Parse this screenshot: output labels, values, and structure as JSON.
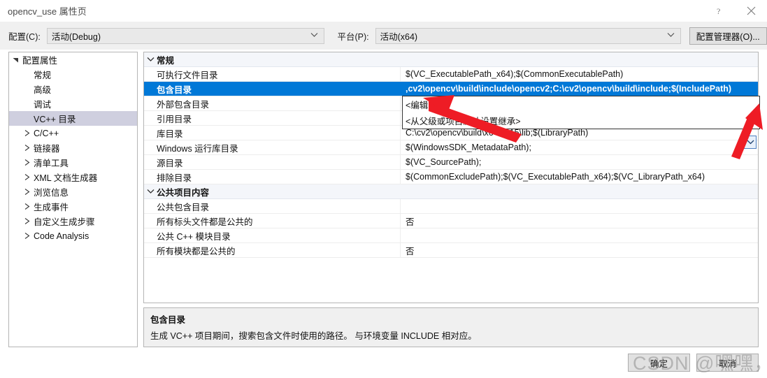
{
  "window": {
    "title": "opencv_use 属性页",
    "help_icon": "help-icon",
    "close_icon": "close-icon"
  },
  "toolbar": {
    "configuration_label": "配置(C):",
    "configuration_value": "活动(Debug)",
    "platform_label": "平台(P):",
    "platform_value": "活动(x64)",
    "config_manager_label": "配置管理器(O)..."
  },
  "tree": {
    "items": [
      {
        "label": "配置属性",
        "indent": 0,
        "twisty": "expanded",
        "selected": false
      },
      {
        "label": "常规",
        "indent": 1,
        "twisty": "none",
        "selected": false
      },
      {
        "label": "高级",
        "indent": 1,
        "twisty": "none",
        "selected": false
      },
      {
        "label": "调试",
        "indent": 1,
        "twisty": "none",
        "selected": false
      },
      {
        "label": "VC++ 目录",
        "indent": 1,
        "twisty": "none",
        "selected": true
      },
      {
        "label": "C/C++",
        "indent": 1,
        "twisty": "collapsed",
        "selected": false
      },
      {
        "label": "链接器",
        "indent": 1,
        "twisty": "collapsed",
        "selected": false
      },
      {
        "label": "清单工具",
        "indent": 1,
        "twisty": "collapsed",
        "selected": false
      },
      {
        "label": "XML 文档生成器",
        "indent": 1,
        "twisty": "collapsed",
        "selected": false
      },
      {
        "label": "浏览信息",
        "indent": 1,
        "twisty": "collapsed",
        "selected": false
      },
      {
        "label": "生成事件",
        "indent": 1,
        "twisty": "collapsed",
        "selected": false
      },
      {
        "label": "自定义生成步骤",
        "indent": 1,
        "twisty": "collapsed",
        "selected": false
      },
      {
        "label": "Code Analysis",
        "indent": 1,
        "twisty": "collapsed",
        "selected": false
      }
    ]
  },
  "grid": {
    "sections": [
      {
        "title": "常规",
        "rows": [
          {
            "name": "可执行文件目录",
            "value": "$(VC_ExecutablePath_x64);$(CommonExecutablePath)",
            "selected": false
          },
          {
            "name": "包含目录",
            "value": ",cv2\\opencv\\build\\include\\opencv2;C:\\cv2\\opencv\\build\\include;$(IncludePath)",
            "selected": true
          },
          {
            "name": "外部包含目录",
            "value": "",
            "selected": false
          },
          {
            "name": "引用目录",
            "value": "",
            "selected": false
          },
          {
            "name": "库目录",
            "value": "C:\\cv2\\opencv\\build\\x64\\vc15\\lib;$(LibraryPath)",
            "selected": false
          },
          {
            "name": "Windows 运行库目录",
            "value": "$(WindowsSDK_MetadataPath);",
            "selected": false
          },
          {
            "name": "源目录",
            "value": "$(VC_SourcePath);",
            "selected": false
          },
          {
            "name": "排除目录",
            "value": "$(CommonExcludePath);$(VC_ExecutablePath_x64);$(VC_LibraryPath_x64)",
            "selected": false
          }
        ]
      },
      {
        "title": "公共项目内容",
        "rows": [
          {
            "name": "公共包含目录",
            "value": "",
            "selected": false
          },
          {
            "name": "所有标头文件都是公共的",
            "value": "否",
            "selected": false
          },
          {
            "name": "公共 C++ 模块目录",
            "value": "",
            "selected": false
          },
          {
            "name": "所有模块都是公共的",
            "value": "否",
            "selected": false
          }
        ]
      }
    ],
    "value_dropdown_icon": "chevron-down-icon"
  },
  "dropdown": {
    "items": [
      {
        "label": "<编辑...>"
      },
      {
        "label": "<从父级或项目默认设置继承>"
      }
    ]
  },
  "description": {
    "title": "包含目录",
    "body": "生成 VC++ 项目期间，搜索包含文件时使用的路径。 与环境变量 INCLUDE 相对应。"
  },
  "footer": {
    "ok_label": "确定",
    "cancel_label": "取消"
  },
  "annotations": {
    "watermark": "CSDN @嘿嘿，不尴不笑",
    "arrow_color": "#ee1c25"
  }
}
